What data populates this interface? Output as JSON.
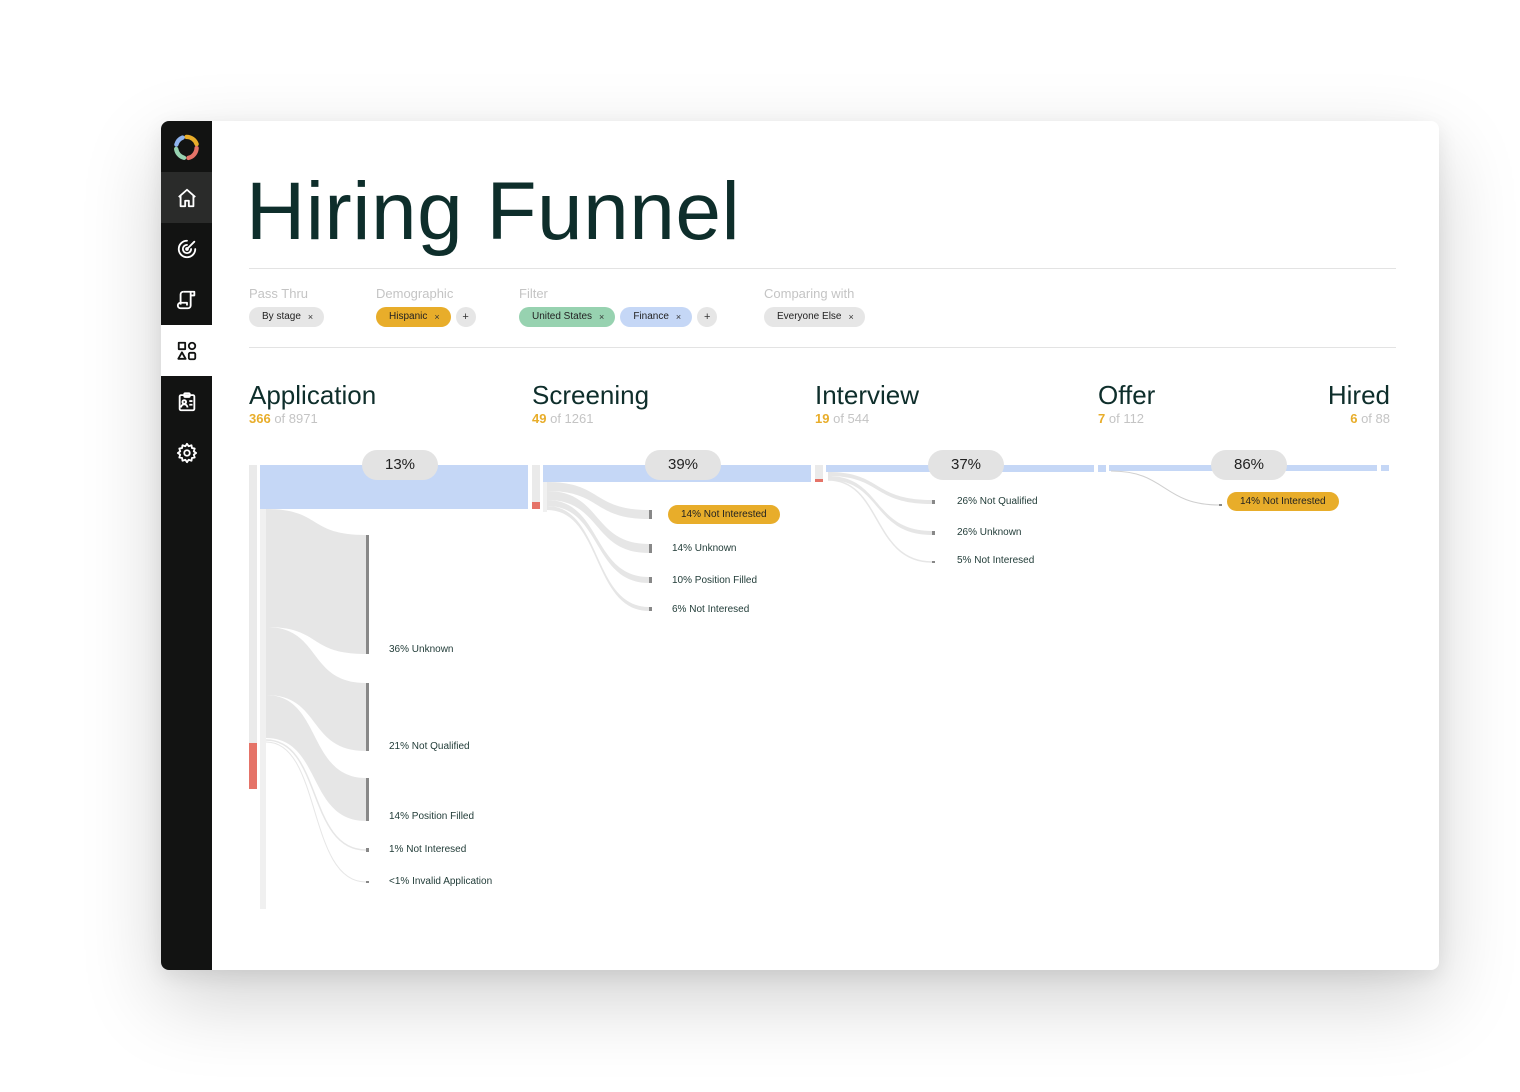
{
  "title": "Hiring Funnel",
  "filters": {
    "pass_thru": {
      "label": "Pass Thru",
      "chips": [
        "By stage"
      ]
    },
    "demographic": {
      "label": "Demographic",
      "chips": [
        "Hispanic"
      ]
    },
    "filter": {
      "label": "Filter",
      "chips": [
        "United States",
        "Finance"
      ]
    },
    "comparing": {
      "label": "Comparing with",
      "chips": [
        "Everyone Else"
      ]
    },
    "remove_glyph": "×",
    "add_glyph": "+"
  },
  "stages": [
    {
      "name": "Application",
      "count": "366",
      "of_total": "of 8971"
    },
    {
      "name": "Screening",
      "count": "49",
      "of_total": "of 1261"
    },
    {
      "name": "Interview",
      "count": "19",
      "of_total": "of 544"
    },
    {
      "name": "Offer",
      "count": "7",
      "of_total": "of 112"
    },
    {
      "name": "Hired",
      "count": "6",
      "of_total": "of 88"
    }
  ],
  "pass_rates": [
    "13%",
    "39%",
    "37%",
    "86%"
  ],
  "dropoffs": {
    "application": [
      {
        "label": "36% Unknown",
        "value": 36
      },
      {
        "label": "21% Not Qualified",
        "value": 21
      },
      {
        "label": "14% Position Filled",
        "value": 14
      },
      {
        "label": "1% Not Interesed",
        "value": 1
      },
      {
        "label": "<1% Invalid Application",
        "value": 0.5
      }
    ],
    "screening": [
      {
        "label": "14% Not Interested",
        "value": 14,
        "highlight": true
      },
      {
        "label": "14% Unknown",
        "value": 14
      },
      {
        "label": "10% Position Filled",
        "value": 10
      },
      {
        "label": "6% Not Interesed",
        "value": 6
      }
    ],
    "interview": [
      {
        "label": "26% Not Qualified",
        "value": 26
      },
      {
        "label": "26% Unknown",
        "value": 26
      },
      {
        "label": "5% Not Interesed",
        "value": 5
      }
    ],
    "offer": [
      {
        "label": "14% Not Interested",
        "value": 14,
        "highlight": true
      }
    ]
  },
  "colors": {
    "pass_bar": "#c5d7f6",
    "group_highlight": "#e57368",
    "flow": "#e6e6e6",
    "accent": "#e8ad2a",
    "title": "#0e2e2b"
  },
  "icons": {
    "sidebar": [
      "home-icon",
      "target-icon",
      "scroll-icon",
      "shapes-icon",
      "clipboard-user-icon",
      "gear-icon"
    ]
  }
}
